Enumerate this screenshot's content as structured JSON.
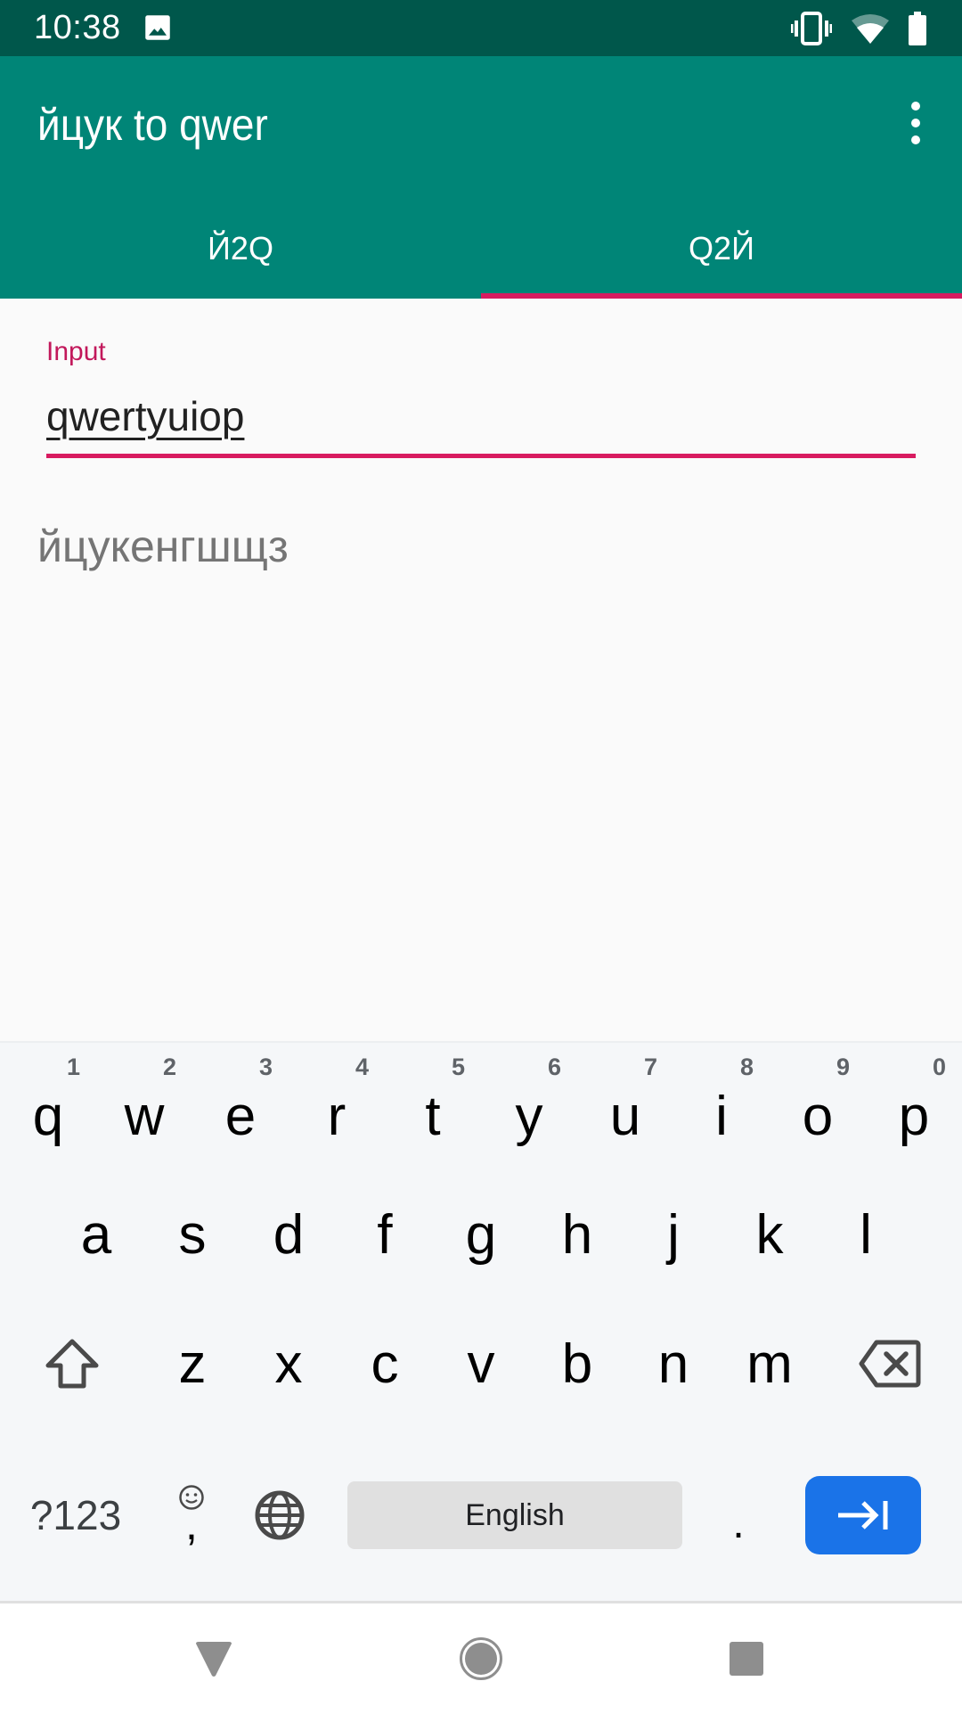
{
  "status_bar": {
    "time": "10:38",
    "icons": [
      "image-notification-icon",
      "vibrate-icon",
      "wifi-icon",
      "battery-icon"
    ]
  },
  "app_bar": {
    "title": "йцук to qwer",
    "overflow_icon": "more-vert-icon"
  },
  "tabs": [
    {
      "label": "Й2Q",
      "active": false
    },
    {
      "label": "Q2Й",
      "active": true
    }
  ],
  "input_field": {
    "label": "Input",
    "value": "qwertyuiop"
  },
  "output_text": "йцукенгшщз",
  "colors": {
    "primary": "#008577",
    "primary_dark": "#00574b",
    "accent": "#d81b60",
    "keyboard_action": "#1a73e8"
  },
  "keyboard": {
    "row1": [
      {
        "key": "q",
        "hint": "1"
      },
      {
        "key": "w",
        "hint": "2"
      },
      {
        "key": "e",
        "hint": "3"
      },
      {
        "key": "r",
        "hint": "4"
      },
      {
        "key": "t",
        "hint": "5"
      },
      {
        "key": "y",
        "hint": "6"
      },
      {
        "key": "u",
        "hint": "7"
      },
      {
        "key": "i",
        "hint": "8"
      },
      {
        "key": "o",
        "hint": "9"
      },
      {
        "key": "p",
        "hint": "0"
      }
    ],
    "row2": [
      "a",
      "s",
      "d",
      "f",
      "g",
      "h",
      "j",
      "k",
      "l"
    ],
    "row3": [
      "z",
      "x",
      "c",
      "v",
      "b",
      "n",
      "m"
    ],
    "symbols_label": "?123",
    "comma": ",",
    "space_label": "English",
    "period": ".",
    "shift_icon": "shift-icon",
    "backspace_icon": "backspace-icon",
    "emoji_icon": "emoji-icon",
    "globe_icon": "globe-icon",
    "enter_icon": "tab-next-icon"
  },
  "nav_bar": {
    "buttons": [
      "back-icon",
      "home-icon",
      "recents-icon"
    ]
  }
}
